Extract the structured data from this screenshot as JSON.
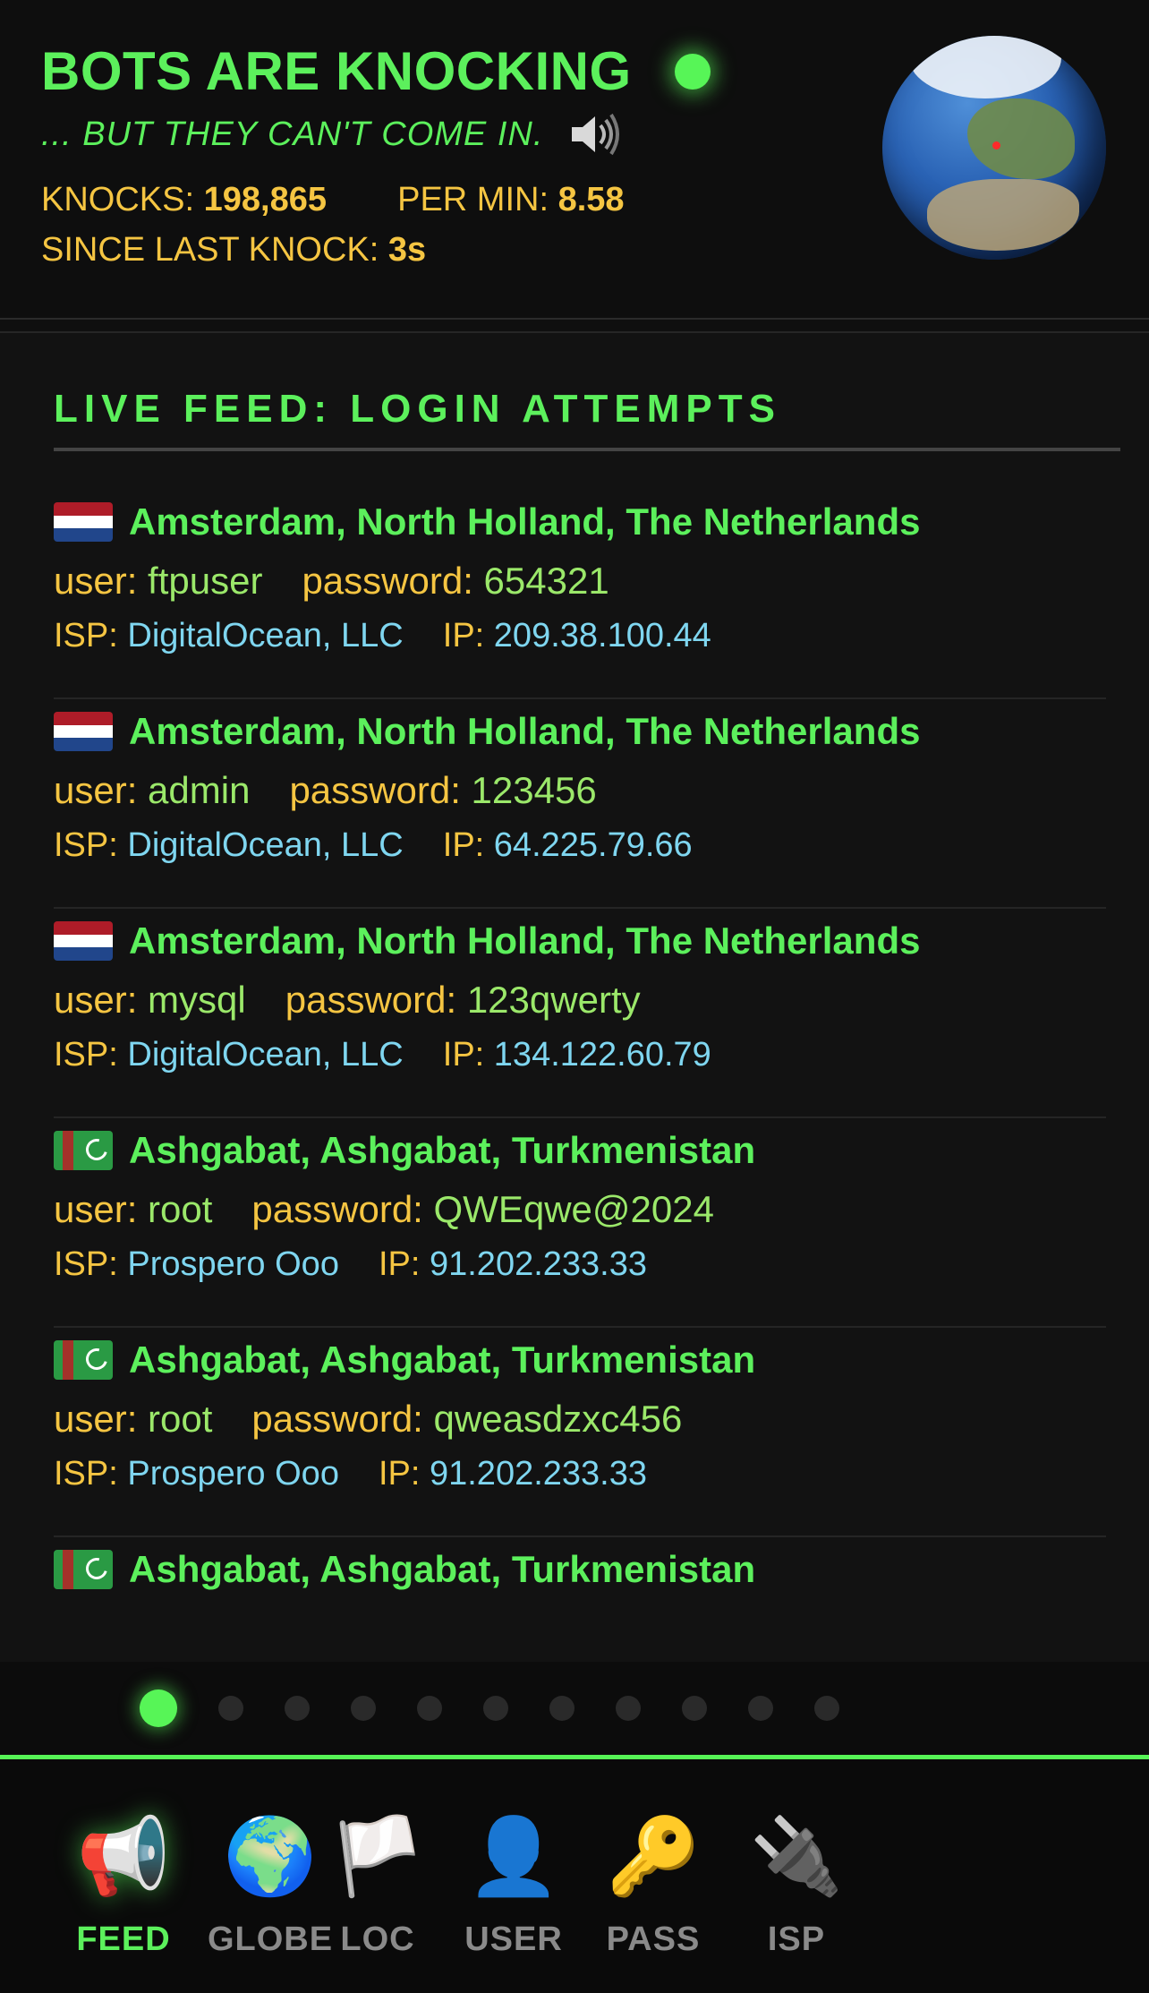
{
  "header": {
    "title": "BOTS ARE KNOCKING",
    "subtitle": "... BUT THEY CAN'T COME IN.",
    "speaker_icon": "speaker-icon",
    "knocks_label": "KNOCKS:",
    "knocks_value": "198,865",
    "per_min_label": "PER MIN:",
    "per_min_value": "8.58",
    "since_label": "SINCE LAST KNOCK:",
    "since_value": "3s",
    "status_color": "#57f557"
  },
  "feed": {
    "title": "LIVE FEED: LOGIN ATTEMPTS",
    "labels": {
      "user": "user:",
      "password": "password:",
      "isp": "ISP:",
      "ip": "IP:"
    },
    "entries": [
      {
        "flag": "NL",
        "location": "Amsterdam, North Holland, The Netherlands",
        "user": "ftpuser",
        "password": "654321",
        "isp": "DigitalOcean, LLC",
        "ip": "209.38.100.44"
      },
      {
        "flag": "NL",
        "location": "Amsterdam, North Holland, The Netherlands",
        "user": "admin",
        "password": "123456",
        "isp": "DigitalOcean, LLC",
        "ip": "64.225.79.66"
      },
      {
        "flag": "NL",
        "location": "Amsterdam, North Holland, The Netherlands",
        "user": "mysql",
        "password": "123qwerty",
        "isp": "DigitalOcean, LLC",
        "ip": "134.122.60.79"
      },
      {
        "flag": "TM",
        "location": "Ashgabat, Ashgabat, Turkmenistan",
        "user": "root",
        "password": "QWEqwe@2024",
        "isp": "Prospero Ooo",
        "ip": "91.202.233.33"
      },
      {
        "flag": "TM",
        "location": "Ashgabat, Ashgabat, Turkmenistan",
        "user": "root",
        "password": "qweasdzxc456",
        "isp": "Prospero Ooo",
        "ip": "91.202.233.33"
      },
      {
        "flag": "TM",
        "location": "Ashgabat, Ashgabat, Turkmenistan"
      }
    ]
  },
  "pager": {
    "total": 11,
    "active_index": 0
  },
  "tabs": [
    {
      "label": "FEED",
      "icon": "megaphone-icon",
      "glyph": "📢"
    },
    {
      "label": "GLOBE",
      "icon": "globe-icon",
      "glyph": "🌍"
    },
    {
      "label": "LOC",
      "icon": "white-flag-icon",
      "glyph": "🏳️"
    },
    {
      "label": "USER",
      "icon": "user-silhouette-icon",
      "glyph": "👤"
    },
    {
      "label": "PASS",
      "icon": "key-icon",
      "glyph": "🔑"
    },
    {
      "label": "ISP",
      "icon": "plug-icon",
      "glyph": "🔌"
    }
  ],
  "colors": {
    "accent": "#5cf05c",
    "label": "#f5c542",
    "value": "#9be86a",
    "network": "#7fd6f0"
  }
}
